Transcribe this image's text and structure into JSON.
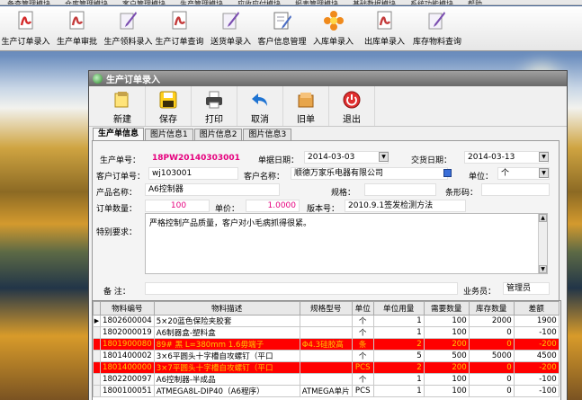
{
  "top_menu": [
    "备查管理模块",
    "仓库管理模块",
    "客户管理模块",
    "生产管理模块",
    "应收应付模块",
    "报表管理模块",
    "基础数据模块",
    "系统功能模块",
    "帮助"
  ],
  "main_toolbar": [
    {
      "label": "生产订单录入",
      "icon": "pdf-document-icon",
      "color": "#d42a2a"
    },
    {
      "label": "生产单审批",
      "icon": "pdf-approve-icon",
      "color": "#c43a3a"
    },
    {
      "label": "生产领料录入",
      "icon": "feather-pen-icon",
      "color": "#7a4db0"
    },
    {
      "label": "生产订单查询",
      "icon": "pdf-search-icon",
      "color": "#c43a3a"
    },
    {
      "label": "送货单录入",
      "icon": "feather-pen-icon",
      "color": "#7a4db0"
    },
    {
      "label": "客户信息管理",
      "icon": "pen-paper-icon",
      "color": "#4b6dc4"
    },
    {
      "label": "入库单录入",
      "icon": "flower-icon",
      "color": "#f08a1c"
    },
    {
      "label": "出库单录入",
      "icon": "pdf-document-icon",
      "color": "#c43a3a"
    },
    {
      "label": "库存物料查询",
      "icon": "feather-pen-icon",
      "color": "#7a4db0"
    }
  ],
  "dialog": {
    "title": "生产订单录入",
    "toolbar": [
      {
        "label": "新建",
        "icon": "new-document-icon"
      },
      {
        "label": "保存",
        "icon": "save-floppy-icon"
      },
      {
        "label": "打印",
        "icon": "printer-icon"
      },
      {
        "label": "取消",
        "icon": "undo-arrow-icon"
      },
      {
        "label": "旧单",
        "icon": "old-order-icon"
      },
      {
        "label": "退出",
        "icon": "exit-power-icon"
      }
    ],
    "tabs": [
      "生产单信息",
      "图片信息1",
      "图片信息2",
      "图片信息3"
    ],
    "form": {
      "order_no_label": "生产单号：",
      "order_no": "18PW20140303001",
      "doc_date_label": "单据日期：",
      "doc_date": "2014-03-03",
      "delivery_date_label": "交货日期：",
      "delivery_date": "2014-03-13",
      "cust_order_label": "客户订单号：",
      "cust_order": "wj103001",
      "cust_name_label": "客户名称：",
      "cust_name": "顺德万家乐电器有限公司",
      "unit_label": "单位：",
      "unit": "个",
      "product_label": "产品名称：",
      "product": "A6控制器",
      "spec_label": "规格：",
      "spec": "",
      "barcode_label": "条形码：",
      "barcode": "",
      "qty_label": "订单数量：",
      "qty": "100",
      "price_label": "单价：",
      "price": "1.0000",
      "version_label": "版本号：",
      "version": "2010.9.1签发检测方法",
      "special_label": "特别要求：",
      "special": "严格控制产品质量，客户对小毛病抓得很紧。",
      "remark_label": "备  注：",
      "remark": "",
      "salesman_label": "业务员：",
      "salesman": "管理员"
    },
    "grid": {
      "columns": [
        "物料编号",
        "物料描述",
        "规格型号",
        "单位",
        "单位用量",
        "需要数量",
        "库存数量",
        "差额"
      ],
      "rows": [
        {
          "code": "1802600004",
          "desc": "5×20蓝色保险夹胶套",
          "spec": "",
          "unit": "个",
          "per": "1",
          "need": "100",
          "stock": "2000",
          "diff": "1900",
          "style": "sel"
        },
        {
          "code": "1802000019",
          "desc": "A6制器盒-塑料盒",
          "spec": "",
          "unit": "个",
          "per": "1",
          "need": "100",
          "stock": "0",
          "diff": "-100",
          "style": ""
        },
        {
          "code": "1801900080",
          "desc": "89# 黑 L=380mm 1.6毋端子",
          "spec": "Φ4.3硅胶高",
          "unit": "条",
          "per": "2",
          "need": "200",
          "stock": "0",
          "diff": "-200",
          "style": "red"
        },
        {
          "code": "1801400002",
          "desc": "3×6平圆头十字槽自攻螺钉（平口",
          "spec": "",
          "unit": "个",
          "per": "5",
          "need": "500",
          "stock": "5000",
          "diff": "4500",
          "style": ""
        },
        {
          "code": "1801400000",
          "desc": "3×7平圆头十字槽自攻螺钉（平口",
          "spec": "",
          "unit": "PCS",
          "per": "2",
          "need": "200",
          "stock": "0",
          "diff": "-200",
          "style": "red"
        },
        {
          "code": "1802200097",
          "desc": "A6控制器-半成品",
          "spec": "",
          "unit": "个",
          "per": "1",
          "need": "100",
          "stock": "0",
          "diff": "-100",
          "style": ""
        },
        {
          "code": "1800100051",
          "desc": "ATMEGA8L-DIP40（A6程序）",
          "spec": "ATMEGA单片",
          "unit": "PCS",
          "per": "1",
          "need": "100",
          "stock": "0",
          "diff": "-100",
          "style": ""
        }
      ]
    }
  }
}
